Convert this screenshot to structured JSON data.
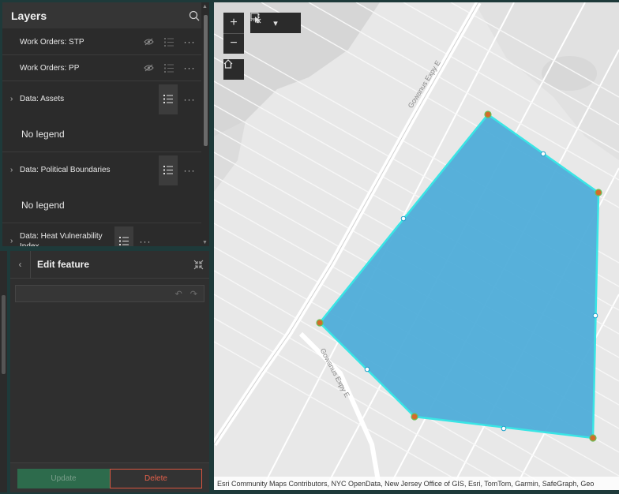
{
  "layers_panel": {
    "title": "Layers",
    "search_icon": "search-icon",
    "items": [
      {
        "label": "Work Orders: STP",
        "visibility_icon": "eye-hidden-icon",
        "legend_icon": "legend-list-icon",
        "more": "···"
      },
      {
        "label": "Work Orders: PP",
        "visibility_icon": "eye-hidden-icon",
        "legend_icon": "legend-list-icon",
        "more": "···"
      },
      {
        "label": "Data: Assets",
        "legend_text": "No legend",
        "more": "···"
      },
      {
        "label": "Data: Political Boundaries",
        "legend_text": "No legend",
        "more": "···"
      },
      {
        "label": "Data: Heat Vulnerability Index",
        "more": "···"
      }
    ]
  },
  "edit_panel": {
    "title": "Edit feature",
    "back_icon": "chevron-left-icon",
    "collapse_icon": "collapse-icon",
    "undo_icon": "undo-icon",
    "redo_icon": "redo-icon",
    "update_label": "Update",
    "delete_label": "Delete"
  },
  "map": {
    "zoom_in": "+",
    "zoom_out": "−",
    "street_label_1": "Gowanus Expy E",
    "street_label_2": "Gowanus Expy E",
    "attribution": "Esri Community Maps Contributors, NYC OpenData, New Jersey Office of GIS, Esri, TomTom, Garmin, SafeGraph, Geo",
    "polygon_fill": "#4aaad8",
    "polygon_outline": "#39e5e5",
    "vertex_color": "#d46b2a"
  },
  "colors": {
    "panel_bg": "#2b2b2b",
    "update_bg": "#2d6b4c",
    "delete_border": "#d9553f"
  }
}
